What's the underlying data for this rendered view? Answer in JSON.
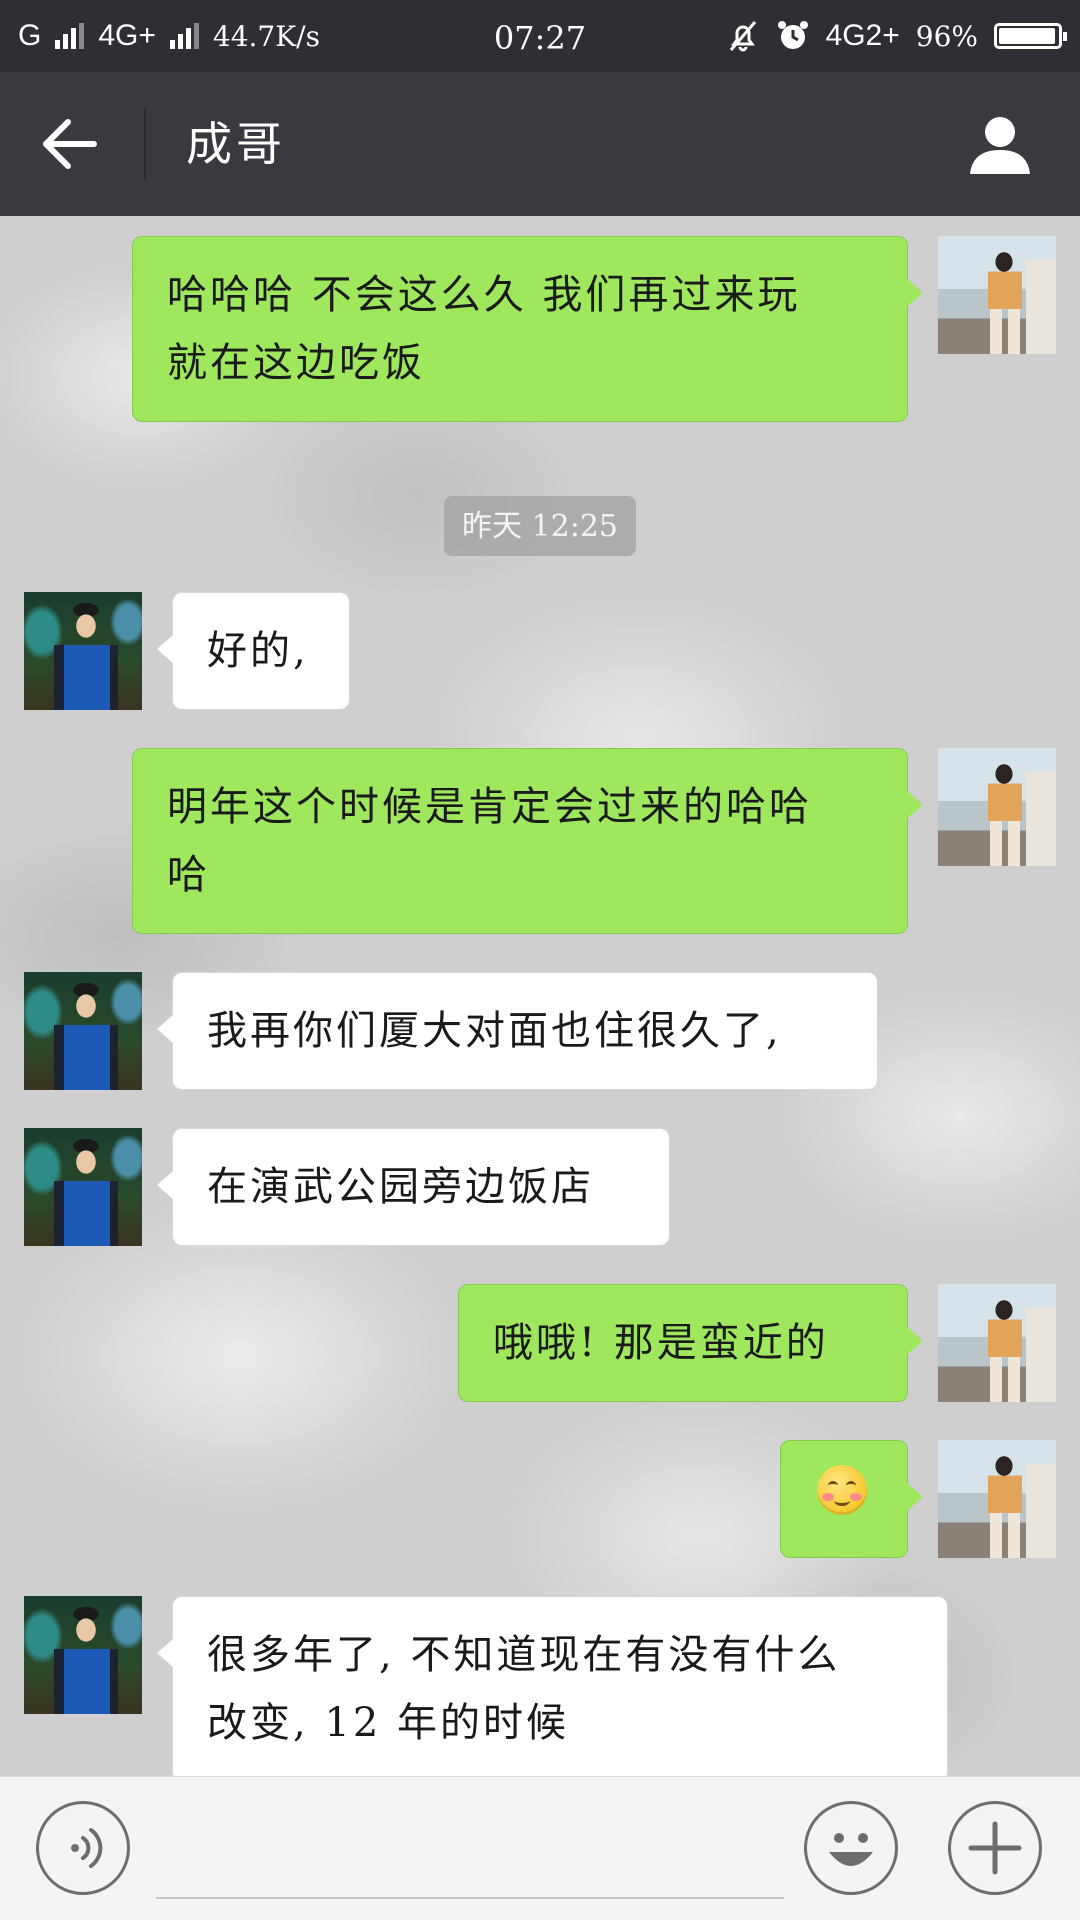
{
  "status_bar": {
    "carrier1": "G",
    "carrier2": "4G+",
    "speed": "44.7K/s",
    "time": "07:27",
    "network_right": "4G2+",
    "battery": "96%",
    "battery_level": 0.96
  },
  "header": {
    "title": "成哥",
    "back_icon": "back-arrow-icon",
    "profile_icon": "person-icon"
  },
  "messages": [
    {
      "sender": "me",
      "lines": [
        "哈哈哈  不会这么久  我们再过来玩",
        "就在这边吃饭"
      ]
    },
    {
      "type": "timestamp",
      "text": "昨天 12:25"
    },
    {
      "sender": "other",
      "lines": [
        "好的,"
      ]
    },
    {
      "sender": "me",
      "lines": [
        "明年这个时候是肯定会过来的哈哈",
        "哈"
      ]
    },
    {
      "sender": "other",
      "lines": [
        "我再你们厦大对面也住很久了,"
      ]
    },
    {
      "sender": "other",
      "lines": [
        "在演武公园旁边饭店"
      ]
    },
    {
      "sender": "me",
      "lines": [
        "哦哦!  那是蛮近的"
      ]
    },
    {
      "sender": "me",
      "emoji": "smiling-blush-emoji"
    },
    {
      "sender": "other",
      "lines": [
        "很多年了, 不知道现在有没有什么",
        "改变, 12 年的时候"
      ]
    }
  ],
  "input_bar": {
    "voice_icon": "voice-icon",
    "input_value": "",
    "emoji_icon": "emoji-face-icon",
    "plus_icon": "plus-icon"
  }
}
